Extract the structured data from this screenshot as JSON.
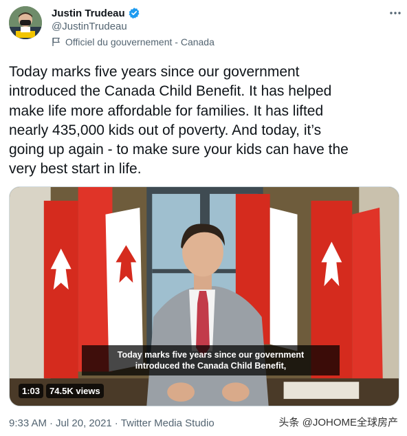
{
  "author": {
    "display_name": "Justin Trudeau",
    "handle": "@JustinTrudeau",
    "label": "Officiel du gouvernement - Canada"
  },
  "tweet": {
    "text": "Today marks five years since our government\nintroduced the Canada Child Benefit. It has helped\nmake life more affordable for families. It has lifted\nnearly 435,000 kids out of poverty. And today, it’s\ngoing up again - to make sure your kids can have the\nvery best start in life."
  },
  "video": {
    "caption_line1": "Today marks five years since our government",
    "caption_line2": "introduced the Canada Child Benefit,",
    "duration": "1:03",
    "views": "74.5K views"
  },
  "meta": {
    "time": "9:33 AM",
    "sep1": "·",
    "date": "Jul 20, 2021",
    "sep2": "·",
    "source": "Twitter Media Studio"
  },
  "watermark": "头条 @JOHOME全球房产",
  "colors": {
    "verified_blue": "#1d9bf0",
    "secondary_text": "#536471",
    "flag_red": "#d52b1e"
  },
  "icons": {
    "verified": "verified-badge-icon",
    "label": "government-flag-icon",
    "more": "more-horizontal-icon"
  }
}
